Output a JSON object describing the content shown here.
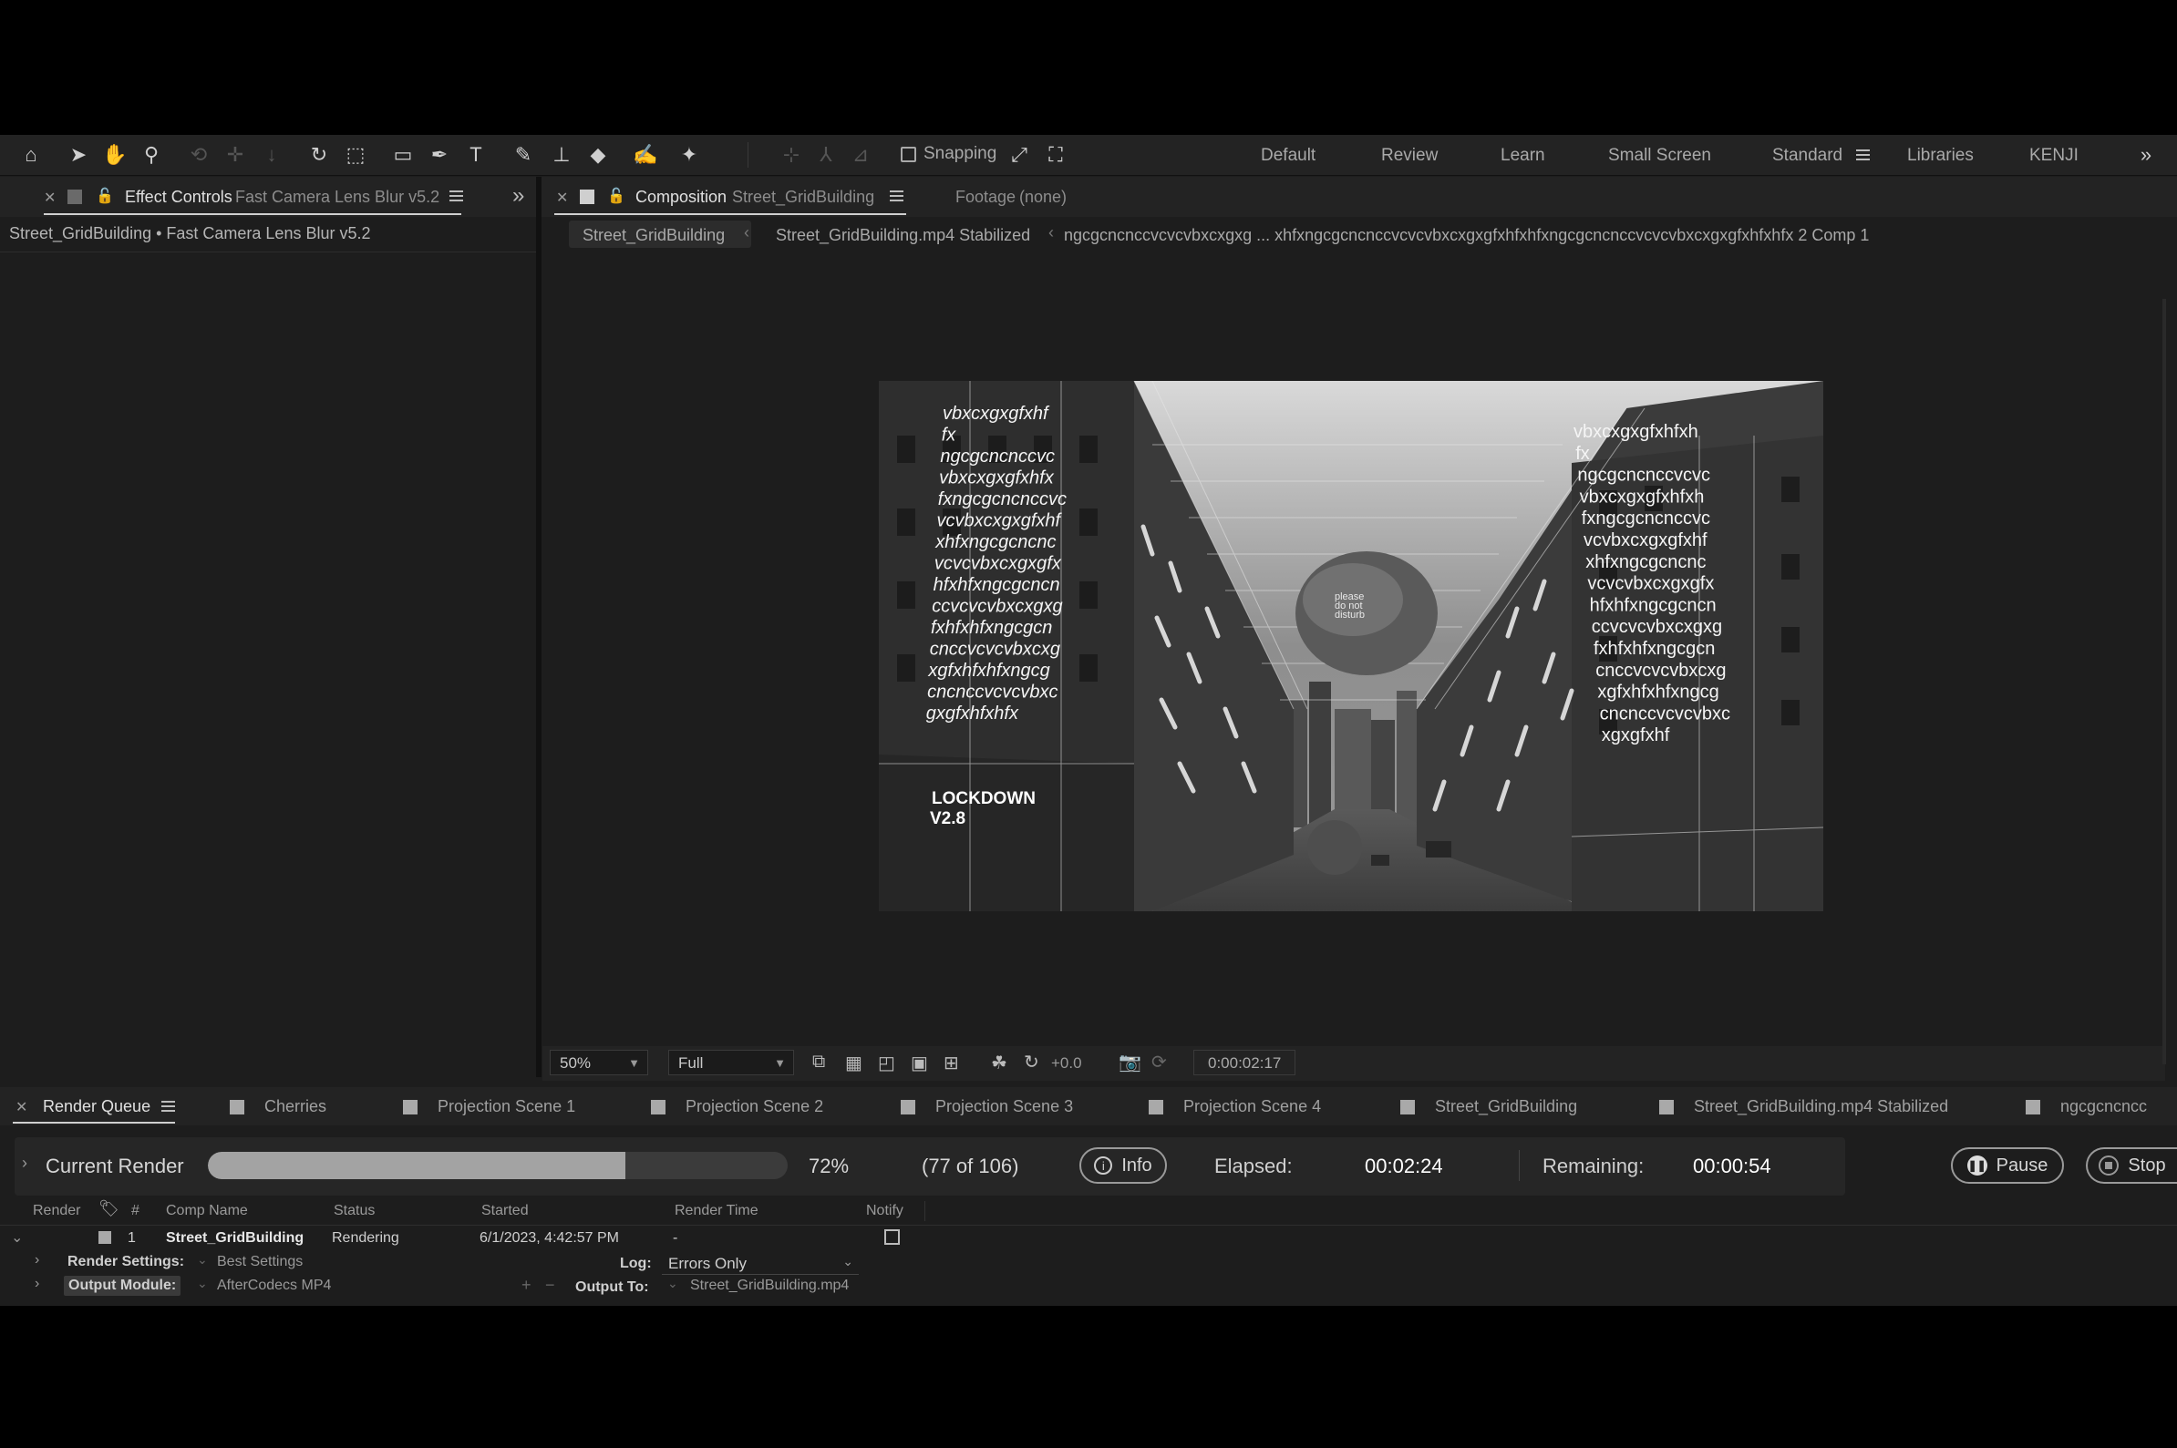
{
  "toolbar": {
    "snapping_label": "Snapping",
    "workspaces": [
      "Default",
      "Review",
      "Learn",
      "Small Screen",
      "Standard",
      "Libraries",
      "KENJI"
    ]
  },
  "effect_controls": {
    "tab_label": "Effect Controls",
    "tab_sub": "Fast Camera Lens Blur v5.2",
    "breadcrumb": "Street_GridBuilding • Fast Camera Lens Blur v5.2"
  },
  "composition": {
    "tab_label": "Composition",
    "tab_sub": "Street_GridBuilding",
    "footage_label": "Footage",
    "footage_value": "(none)",
    "nav": [
      "Street_GridBuilding",
      "Street_GridBuilding.mp4 Stabilized",
      "ngcgcncnccvcvcvbxcxgxg ... xhfxngcgcncnccvcvcvbxcxgxgfxhfxhfxngcgcncnccvcvcvbxcxgxgfxhfxhfx 2 Comp 1"
    ],
    "frame_text": {
      "left_block": [
        "vbxcxgxgfxhf",
        "fx",
        "ngcgcncnccvc",
        "vbxcxgxgfxhfx",
        "fxngcgcncnccvc",
        "vcvbxcxgxgfxhf",
        "xhfxngcgcncnc",
        "vcvcvbxcxgxgfx",
        "hfxhfxngcgcncn",
        "ccvcvcvbxcxgxg",
        "fxhfxhfxngcgcn",
        "cnccvcvcvbxcxg",
        "xgfxhfxhfxngcg",
        "cncnccvcvcvbxc",
        "gxgfxhfxhfx"
      ],
      "right_block": [
        "vbxcxgxgfxhfxh",
        "fx",
        "ngcgcncnccvcvc",
        "vbxcxgxgfxhfxh",
        "fxngcgcncnccvc",
        "vcvbxcxgxgfxhf",
        "xhfxngcgcncnc",
        "vcvcvbxcxgxgfx",
        "hfxhfxngcgcncn",
        "ccvcvcvbxcxgxg",
        "fxhfxhfxngcgcn",
        "cnccvcvcvbxcxg",
        "xgfxhfxhfxngcg",
        "cncnccvcvcvbxc",
        "xgxgfxhf"
      ],
      "lockdown": "LOCKDOWN",
      "version": "V2.8",
      "rock_text": [
        "please",
        "do not",
        "disturb"
      ]
    },
    "zoom": "50%",
    "resolution": "Full",
    "exposure": "+0.0",
    "timecode": "0:00:02:17"
  },
  "render_queue": {
    "tab_label": "Render Queue",
    "tabs": [
      "Cherries",
      "Projection Scene 1",
      "Projection Scene 2",
      "Projection Scene 3",
      "Projection Scene 4",
      "Street_GridBuilding",
      "Street_GridBuilding.mp4 Stabilized",
      "ngcgcncncc"
    ],
    "current_render_label": "Current Render",
    "progress_percent": 72,
    "progress_label": "72%",
    "frames": "(77 of 106)",
    "info_label": "Info",
    "elapsed_label": "Elapsed:",
    "elapsed_value": "00:02:24",
    "remaining_label": "Remaining:",
    "remaining_value": "00:00:54",
    "pause_label": "Pause",
    "stop_label": "Stop",
    "columns": [
      "Render",
      "#",
      "Comp Name",
      "Status",
      "Started",
      "Render Time",
      "Notify"
    ],
    "item": {
      "num": "1",
      "comp_name": "Street_GridBuilding",
      "status": "Rendering",
      "started": "6/1/2023, 4:42:57 PM",
      "render_time": "-",
      "render_settings_label": "Render Settings:",
      "render_settings_value": "Best Settings",
      "log_label": "Log:",
      "log_value": "Errors Only",
      "output_module_label": "Output Module:",
      "output_module_value": "AfterCodecs MP4",
      "output_to_label": "Output To:",
      "output_to_value": "Street_GridBuilding.mp4"
    }
  }
}
